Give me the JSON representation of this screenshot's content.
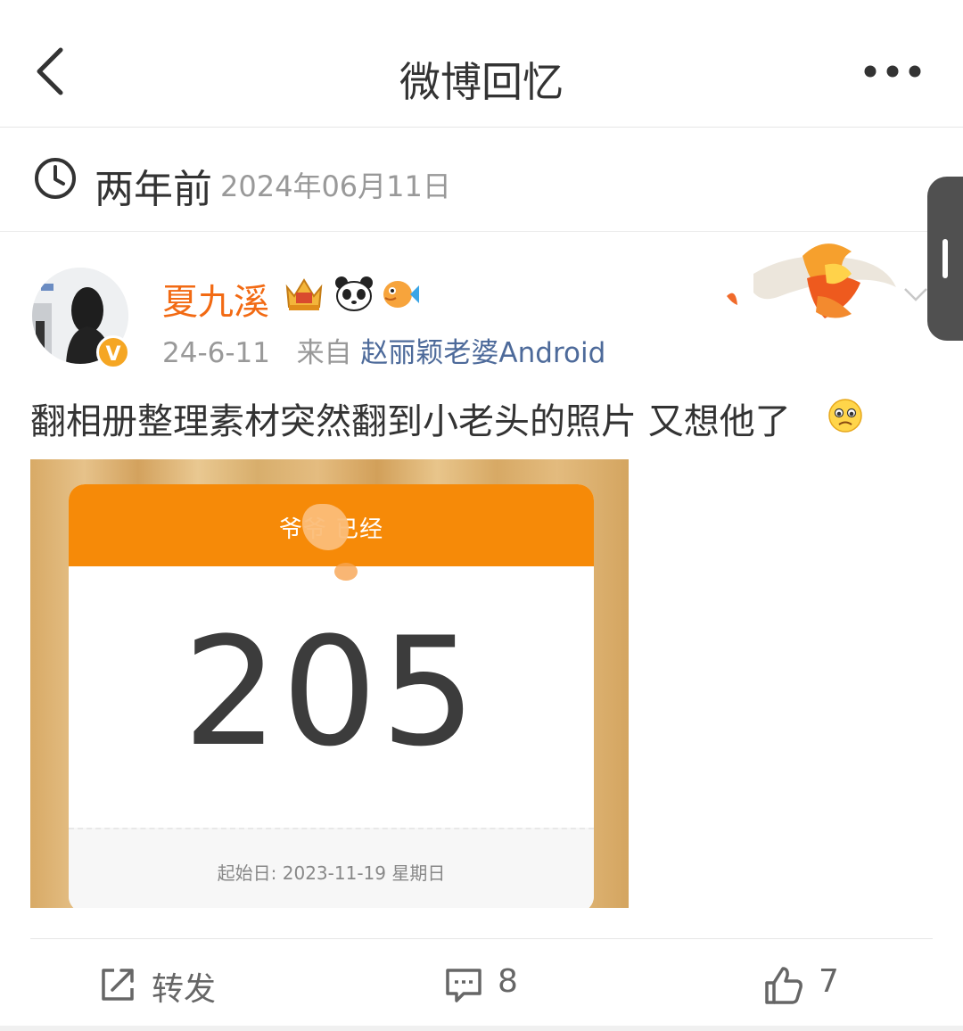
{
  "nav": {
    "title": "微博回忆"
  },
  "memory": {
    "ago": "两年前",
    "date": "2024年06月11日"
  },
  "post": {
    "username": "夏九溪",
    "verify_badge": "V",
    "time": "24-6-11",
    "source_prefix": "来自",
    "source": "赵丽颖老婆Android",
    "text": "翻相册整理素材突然翻到小老头的照片 又想他了",
    "badges": [
      "crown-badge-icon",
      "panda-icon",
      "pufferfish-icon"
    ],
    "emoji": "crying-face-emoji-icon",
    "image": {
      "header": "爷爷 已经",
      "count": "205",
      "start_date": "起始日: 2023-11-19 星期日"
    }
  },
  "actions": {
    "repost_label": "转发",
    "comment_count": "8",
    "like_count": "7"
  },
  "colors": {
    "accent": "#f26a13",
    "link": "#4d6a9a",
    "card_header": "#f68a08"
  }
}
